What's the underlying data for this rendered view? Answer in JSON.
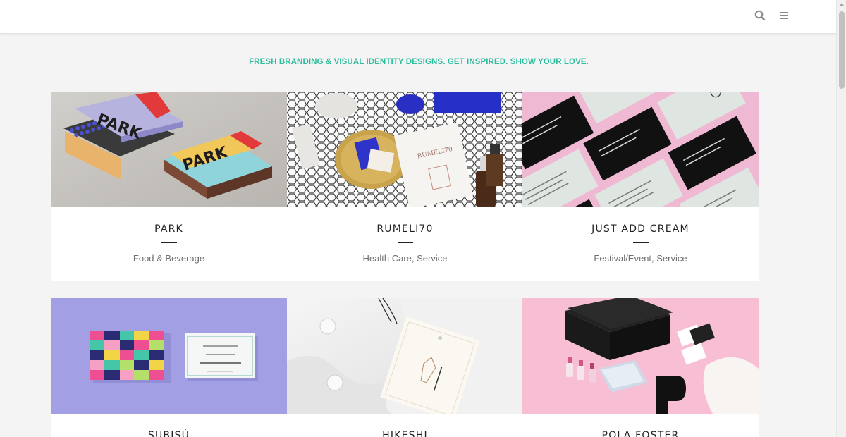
{
  "tagline": "FRESH BRANDING & VISUAL IDENTITY DESIGNS. GET INSPIRED. SHOW YOUR LOVE.",
  "header": {
    "icons": [
      "search-icon",
      "hamburger-menu-icon"
    ]
  },
  "colors": {
    "accent": "#2bbd9d",
    "title": "#222222",
    "category": "#6f6f6f",
    "background": "#f4f4f4"
  },
  "projects": [
    {
      "title": "PARK",
      "category": "Food & Beverage",
      "thumb_bg": "#c7c4c0"
    },
    {
      "title": "RUMELI70",
      "category": "Health Care, Service",
      "thumb_bg": "#ffffff"
    },
    {
      "title": "JUST ADD CREAM",
      "category": "Festival/Event, Service",
      "thumb_bg": "#efb9d4"
    },
    {
      "title": "SUBISÚ",
      "category": "",
      "thumb_bg": "#a29fe4"
    },
    {
      "title": "HIKESHI",
      "category": "",
      "thumb_bg": "#ededed"
    },
    {
      "title": "POLA FOSTER",
      "category": "",
      "thumb_bg": "#f7bed4"
    }
  ]
}
